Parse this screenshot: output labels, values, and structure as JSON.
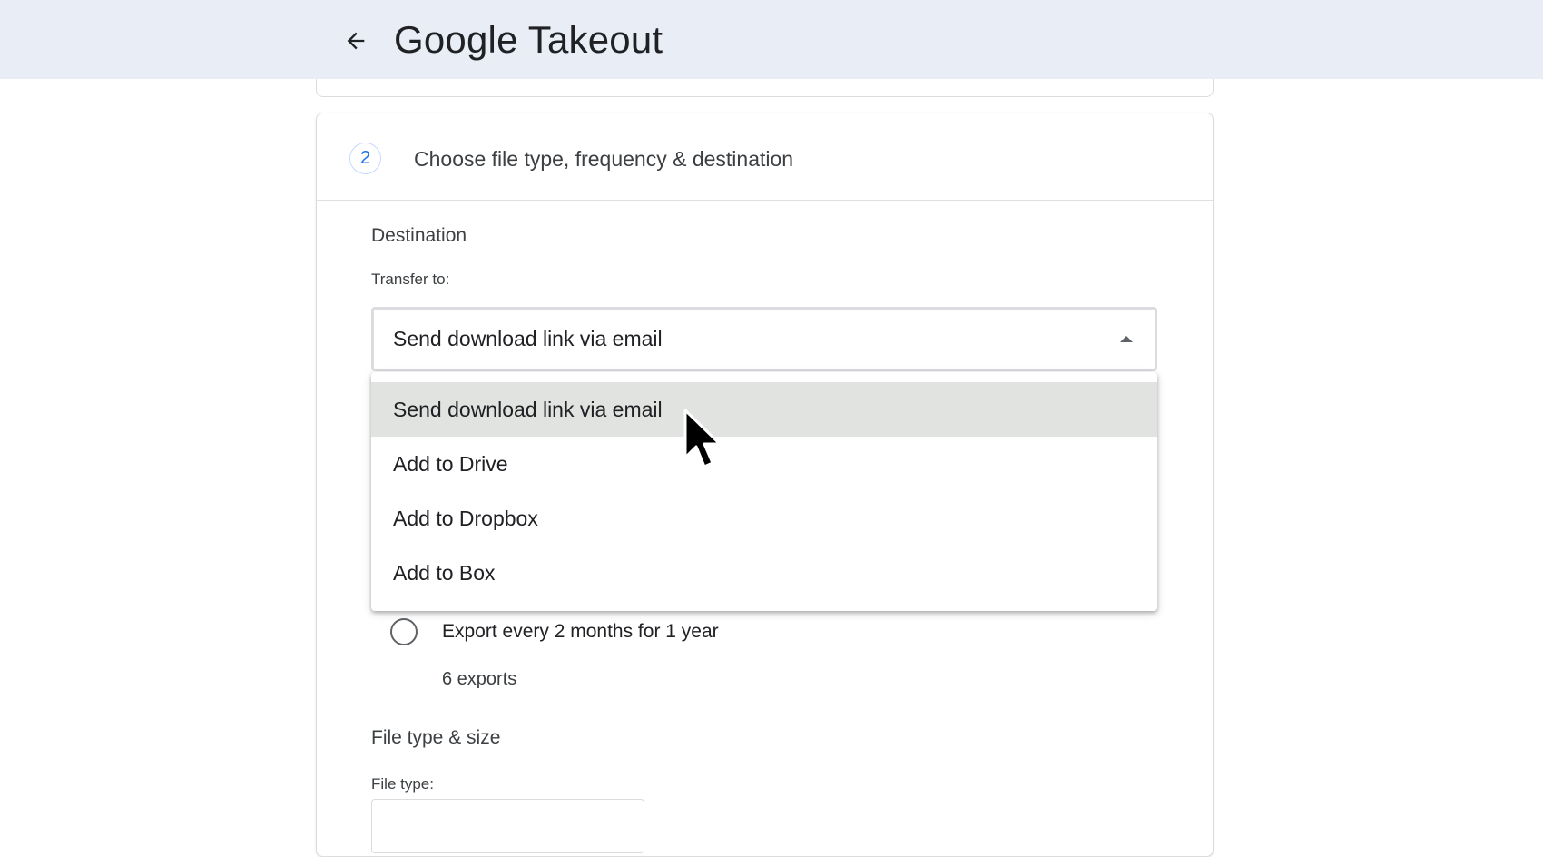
{
  "app": {
    "title": "Google Takeout"
  },
  "step": {
    "number": "2",
    "title": "Choose file type, frequency & destination"
  },
  "destination": {
    "section_title": "Destination",
    "transfer_label": "Transfer to:",
    "selected_value": "Send download link via email",
    "options": [
      "Send download link via email",
      "Add to Drive",
      "Add to Dropbox",
      "Add to Box"
    ]
  },
  "frequency": {
    "option_label": "Export every 2 months for 1 year",
    "option_sub": "6 exports"
  },
  "filetype": {
    "section_title": "File type & size",
    "type_label": "File type:"
  },
  "colors": {
    "appbar_bg": "#e8edf6",
    "accent": "#1a73e8",
    "selected_option_bg": "#e1e3e1"
  },
  "icons": {
    "back": "arrow-left-icon",
    "select_arrow": "caret-up-icon",
    "pointer": "mouse-pointer-icon"
  }
}
